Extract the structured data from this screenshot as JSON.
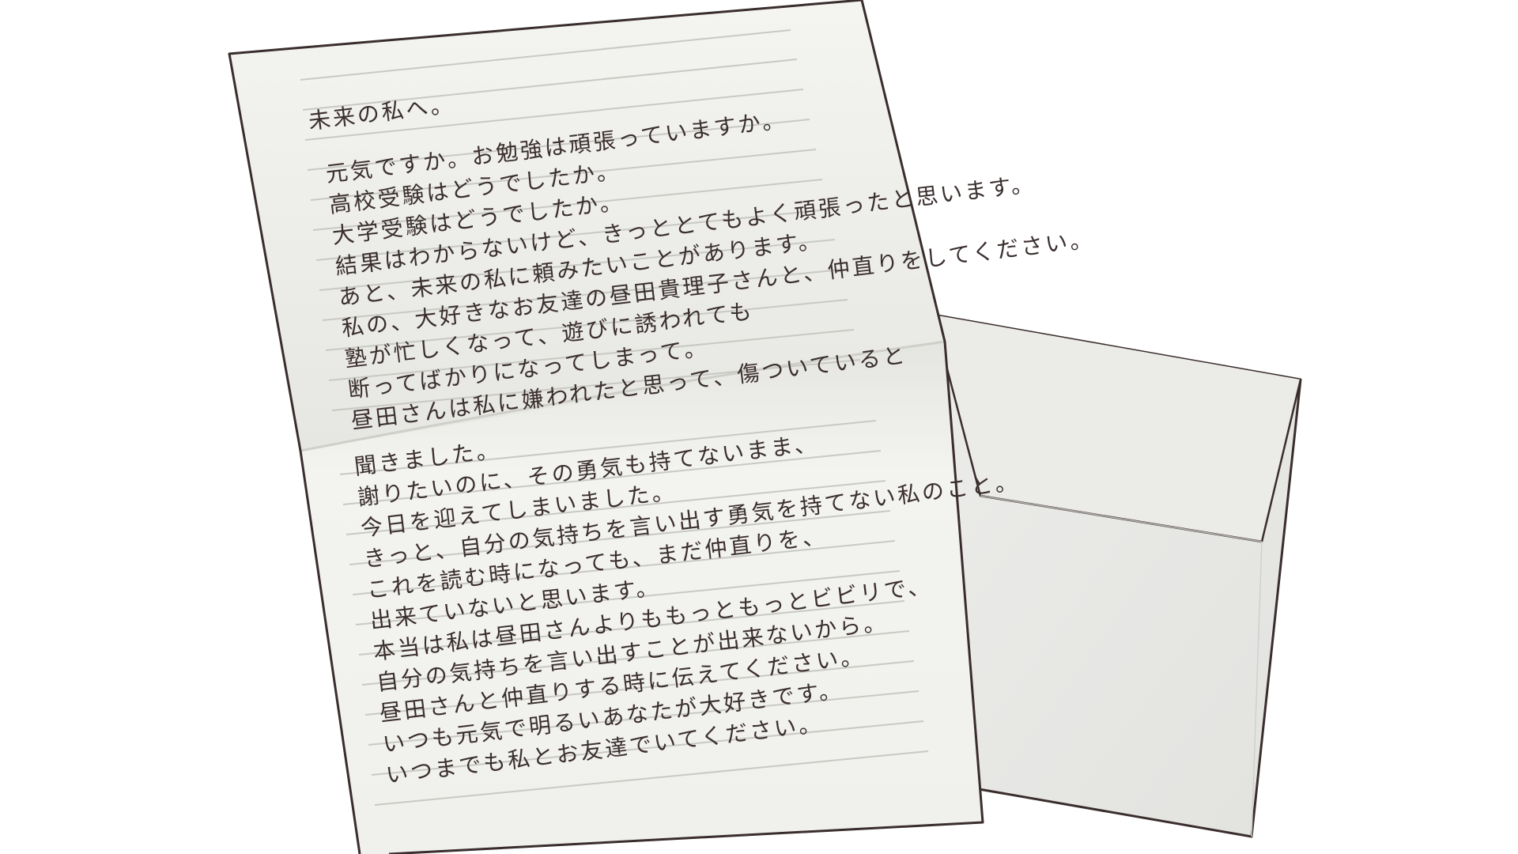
{
  "letter": {
    "salutation": "未来の私へ。",
    "lines": [
      "元気ですか。お勉強は頑張っていますか。",
      "高校受験はどうでしたか。",
      "大学受験はどうでしたか。",
      "結果はわからないけど、きっととてもよく頑張ったと思います。",
      "あと、未来の私に頼みたいことがあります。",
      "私の、大好きなお友達の昼田貴理子さんと、仲直りをしてください。",
      "塾が忙しくなって、遊びに誘われても",
      "断ってばかりになってしまって。",
      "昼田さんは私に嫌われたと思って、傷ついていると",
      "聞きました。",
      "謝りたいのに、その勇気も持てないまま、",
      "今日を迎えてしまいました。",
      "きっと、自分の気持ちを言い出す勇気を持てない私のこと。",
      "これを読む時になっても、まだ仲直りを、",
      "出来ていないと思います。",
      "本当は私は昼田さんよりももっともっとビビリで、",
      "自分の気持ちを言い出すことが出来ないから。",
      "昼田さんと仲直りする時に伝えてください。",
      "いつも元気で明るいあなたが大好きです。",
      "いつまでも私とお友達でいてください。"
    ]
  },
  "colors": {
    "outline": "#3a2d2d",
    "paper": "#f1f0ec",
    "envelope": "#e9e9e6",
    "ink": "#3a2f2e",
    "ruled_line": "#c9c9c4"
  }
}
